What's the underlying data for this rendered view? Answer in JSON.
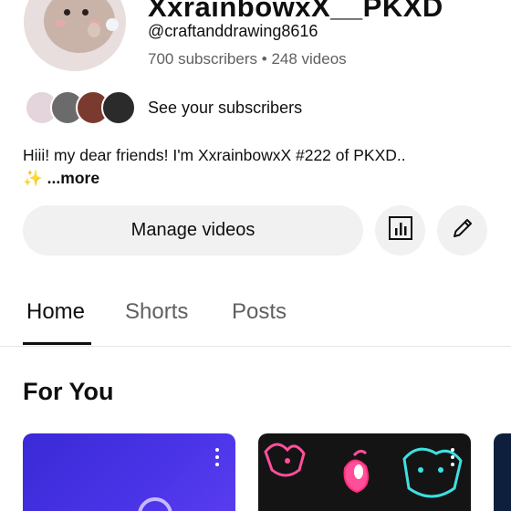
{
  "channel": {
    "name": "XxrainbowxX__PKXD",
    "handle": "@craftanddrawing8616",
    "subscribers": "700 subscribers",
    "separator": "•",
    "videos": "248 videos",
    "see_subscribers": "See your subscribers",
    "description": "Hiii! my dear friends! I'm XxrainbowxX #222  of PKXD..",
    "description_emoji": "✨",
    "more_label": "...more"
  },
  "actions": {
    "manage_videos": "Manage videos",
    "analytics_icon": "bar-chart-icon",
    "edit_icon": "pencil-icon"
  },
  "tabs": [
    {
      "label": "Home",
      "active": true
    },
    {
      "label": "Shorts",
      "active": false
    },
    {
      "label": "Posts",
      "active": false
    }
  ],
  "section": {
    "title": "For You"
  },
  "colors": {
    "accent_text": "#0f0f0f",
    "secondary_text": "#606060",
    "button_bg": "#f1f1f1",
    "thumb1": "#3a2ad6",
    "neon_pink": "#ff4f9a",
    "neon_cyan": "#3fe0e0"
  }
}
